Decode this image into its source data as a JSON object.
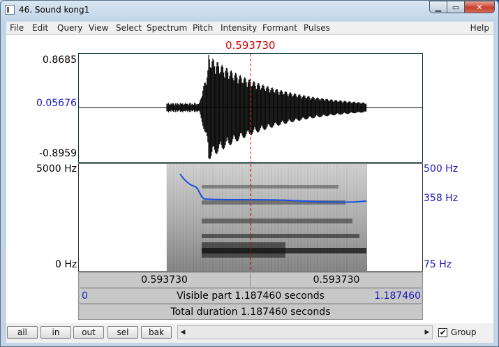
{
  "window": {
    "title": "46. Sound kong1"
  },
  "menu": {
    "items": [
      "File",
      "Edit",
      "Query",
      "View",
      "Select",
      "Spectrum",
      "Pitch",
      "Intensity",
      "Formant",
      "Pulses"
    ],
    "help": "Help"
  },
  "cursor": {
    "time_label": "0.593730",
    "time_fraction": 0.5
  },
  "waveform": {
    "max_label": "0.8685",
    "mid_label": "0.05676",
    "min_label": "-0.8959"
  },
  "spectrogram": {
    "freq_max_label": "5000 Hz",
    "freq_min_label": "0 Hz"
  },
  "pitch": {
    "max_label": "500 Hz",
    "mid_label": "358 Hz",
    "min_label": "75 Hz"
  },
  "time_bars": {
    "left_segment": "0.593730",
    "right_segment": "0.593730",
    "visible_start": "0",
    "visible_part": "Visible part 1.187460 seconds",
    "visible_end": "1.187460",
    "total_duration": "Total duration 1.187460 seconds"
  },
  "buttons": {
    "all": "all",
    "in": "in",
    "out": "out",
    "sel": "sel",
    "bak": "bak"
  },
  "group": {
    "label": "Group",
    "checked": true
  },
  "colors": {
    "pitch_curve": "#1a4fe0",
    "cursor": "#d00000",
    "label_blue": "#1818b8"
  }
}
